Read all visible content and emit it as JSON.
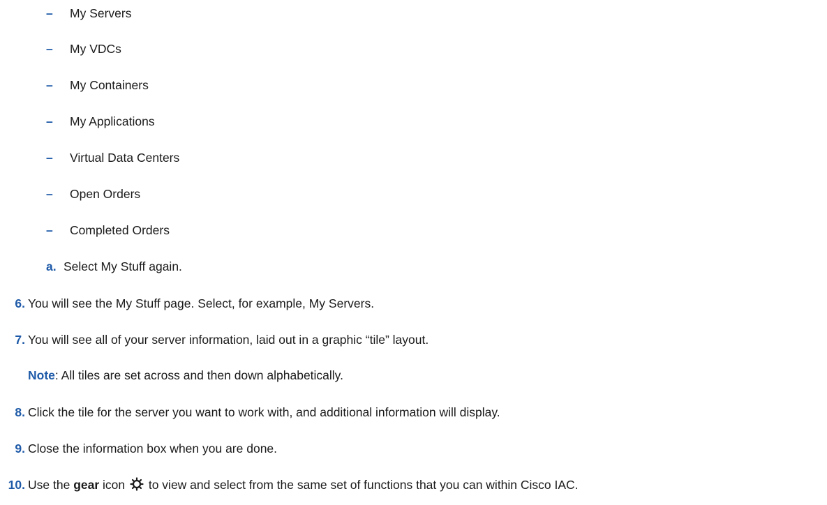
{
  "bullets": [
    "My Servers",
    "My VDCs",
    "My Containers",
    "My Applications",
    "Virtual Data Centers",
    "Open Orders",
    "Completed Orders"
  ],
  "bullet_marker": "–",
  "substep": {
    "letter": "a.",
    "text": "Select My Stuff again."
  },
  "step6": {
    "num": "6.",
    "text": "You will see the My Stuff page. Select, for example, My Servers."
  },
  "step7": {
    "num": "7.",
    "text": "You will see all of your server information, laid out in a graphic “tile” layout."
  },
  "note": {
    "label": "Note",
    "text": ": All tiles are set across and then down alphabetically."
  },
  "step8": {
    "num": "8.",
    "text": "Click the tile for the server you want to work with, and additional information will display."
  },
  "step9": {
    "num": "9.",
    "text": "Close the information box when you are done."
  },
  "step10": {
    "num": "10.",
    "text_before": "Use the ",
    "bold": "gear",
    "text_mid": " icon ",
    "icon": "gear-icon",
    "text_after": " to view and select from the same set of functions that you can within Cisco IAC."
  },
  "colors": {
    "accent": "#1e5aa8",
    "text": "#1a1a1a"
  }
}
